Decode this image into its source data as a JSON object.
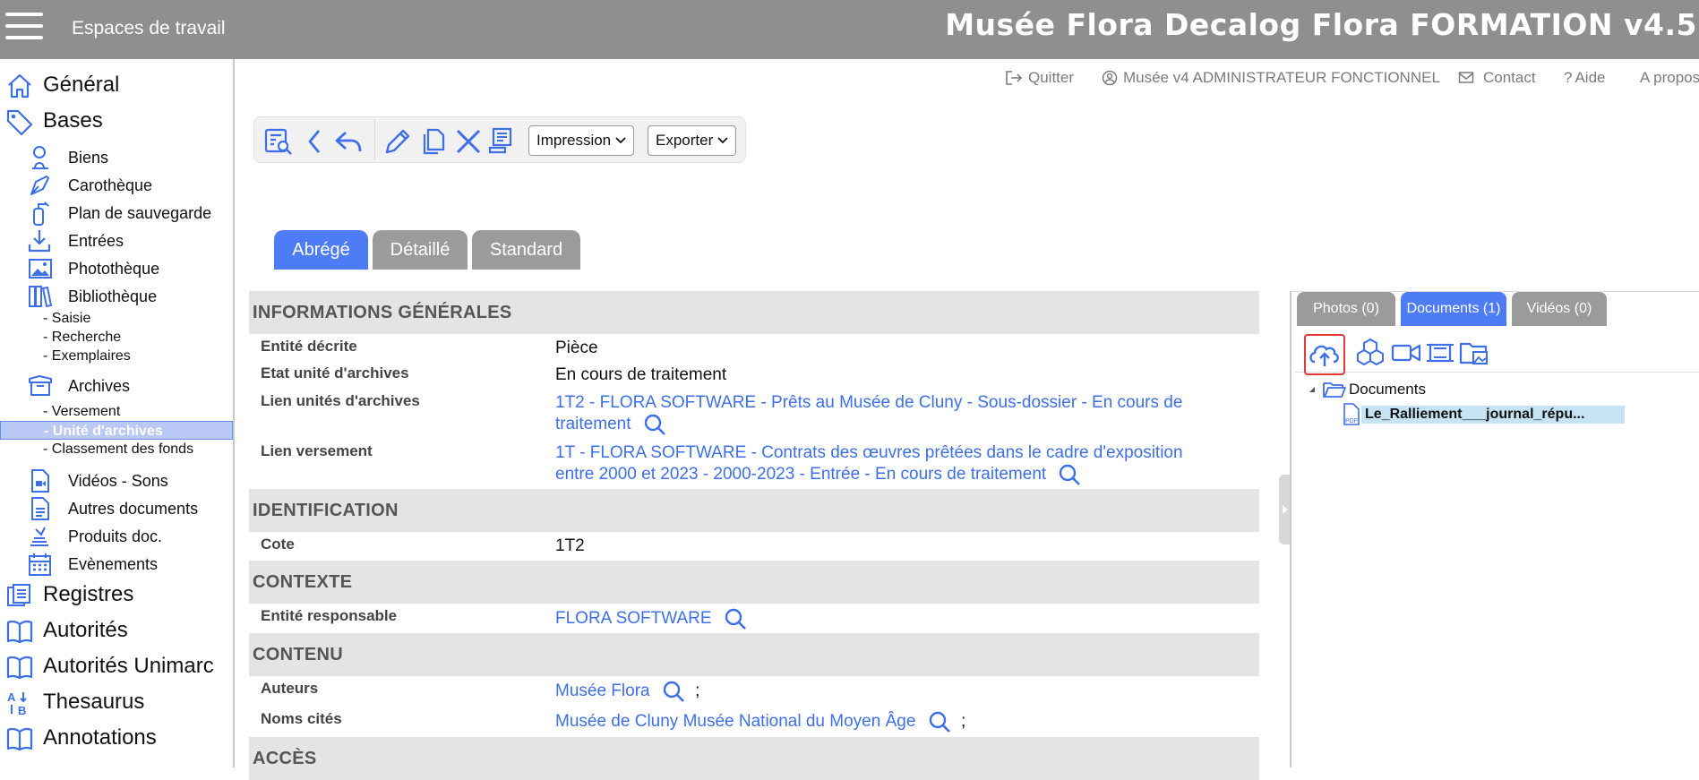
{
  "header": {
    "menu_icon": "hamburger-icon",
    "workspaces": "Espaces de travail",
    "title": "Musée Flora Decalog Flora FORMATION v4.5"
  },
  "toplinks": {
    "quit": "Quitter",
    "user": "Musée v4 ADMINISTRATEUR FONCTIONNEL",
    "contact": "Contact",
    "help": "Aide",
    "about": "A propos"
  },
  "sidebar": {
    "general": "Général",
    "bases": "Bases",
    "biens": "Biens",
    "carotheque": "Carothèque",
    "plan": "Plan de sauvegarde",
    "entrees": "Entrées",
    "phototheque": "Photothèque",
    "bibliotheque": "Bibliothèque",
    "saisie": "- Saisie",
    "recherche": "- Recherche",
    "exemplaires": "- Exemplaires",
    "archives": "Archives",
    "versement": "- Versement",
    "unite": "- Unité d'archives",
    "classement": "- Classement des fonds",
    "videos": "Vidéos - Sons",
    "autres": "Autres documents",
    "produits": "Produits doc.",
    "evenements": "Evènements",
    "registres": "Registres",
    "autorites": "Autorités",
    "autorites_unimarc": "Autorités Unimarc",
    "thesaurus": "Thesaurus",
    "annotations": "Annotations"
  },
  "toolbar": {
    "impression": "Impression",
    "exporter": "Exporter"
  },
  "view_tabs": {
    "abrege": "Abrégé",
    "detaille": "Détaillé",
    "standard": "Standard"
  },
  "sections": {
    "general": {
      "title": "INFORMATIONS GÉNÉRALES",
      "entite_label": "Entité décrite",
      "entite_value": "Pièce",
      "etat_label": "Etat unité d'archives",
      "etat_value": "En cours de traitement",
      "lien_ua_label": "Lien unités d'archives",
      "lien_ua_value": "1T2 - FLORA SOFTWARE - Prêts au Musée de Cluny - Sous-dossier - En cours de traitement",
      "lien_vers_label": "Lien versement",
      "lien_vers_value": "1T - FLORA SOFTWARE - Contrats des œuvres prêtées dans le cadre d'exposition entre 2000 et 2023 - 2000-2023 - Entrée - En cours de traitement"
    },
    "identification": {
      "title": "IDENTIFICATION",
      "cote_label": "Cote",
      "cote_value": "1T2"
    },
    "contexte": {
      "title": "CONTEXTE",
      "entite_resp_label": "Entité responsable",
      "entite_resp_value": "FLORA SOFTWARE"
    },
    "contenu": {
      "title": "CONTENU",
      "auteurs_label": "Auteurs",
      "auteurs_value": "Musée Flora",
      "noms_label": "Noms cités",
      "noms_value": "Musée de Cluny Musée National du Moyen Âge",
      "separator": ";"
    },
    "acces": {
      "title": "ACCÈS"
    }
  },
  "right_panel": {
    "tabs": [
      "Photos (0)",
      "Documents (1)",
      "Vidéos (0)"
    ],
    "active_tab": "Documents (1)",
    "tree_root": "Documents",
    "file_name": "Le_Ralliement___journal_répu..."
  },
  "colors": {
    "accent": "#4d7cf6",
    "header": "#8f8f8f",
    "link": "#3d6fe8",
    "section_bg": "#e4e4e4"
  }
}
